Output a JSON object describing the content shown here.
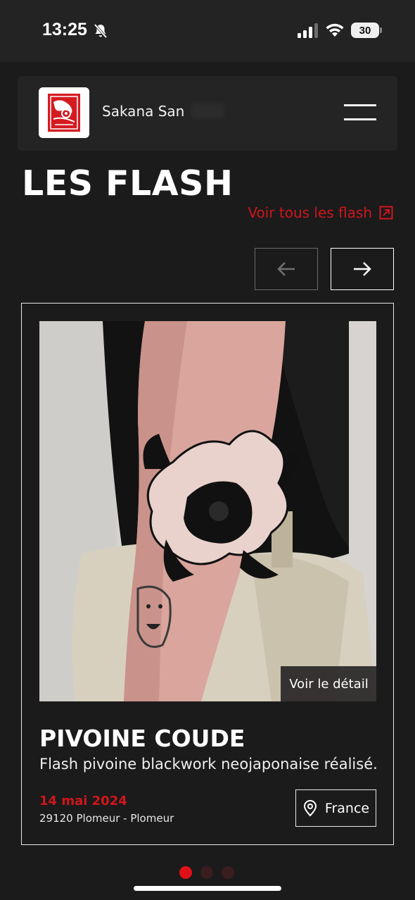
{
  "status_bar": {
    "time": "13:25",
    "battery": "30",
    "icons": [
      "bell-slash-icon",
      "signal-icon",
      "wifi-icon",
      "battery-icon"
    ]
  },
  "header": {
    "site_name": "Sakana San",
    "logo_icon": "koi-seal-logo",
    "menu_icon": "hamburger-icon"
  },
  "page": {
    "title": "LES FLASH",
    "see_all_label": "Voir tous les flash",
    "see_all_icon": "external-link-icon",
    "prev_icon": "arrow-left-icon",
    "next_icon": "arrow-right-icon"
  },
  "card": {
    "detail_label": "Voir le détail",
    "title": "PIVOINE COUDE",
    "description": "Flash pivoine blackwork neojaponaise réalisé...",
    "date": "14 mai 2024",
    "address": "29120 Plomeur - Plomeur",
    "country": "France",
    "country_icon": "map-pin-icon"
  },
  "carousel": {
    "total": 3,
    "active_index": 0
  },
  "colors": {
    "background": "#1b1b1b",
    "accent": "#d0161c",
    "panel": "#242424"
  }
}
